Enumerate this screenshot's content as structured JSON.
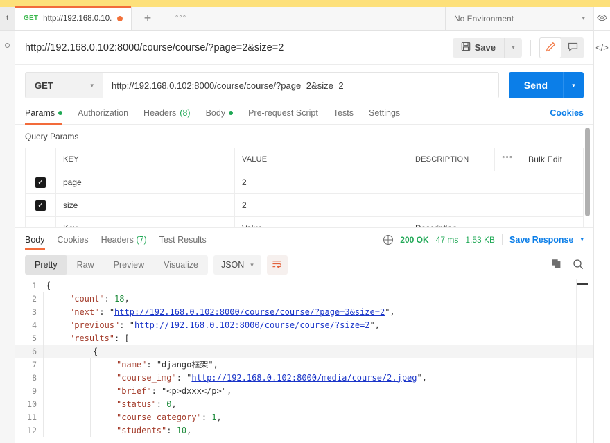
{
  "window": {
    "accent_orange": "#f26b3a",
    "accent_blue": "#0b7ee8",
    "accent_green": "#1fa855",
    "top_bar_color": "#fde07a"
  },
  "tabstrip": {
    "request_tab": {
      "method": "GET",
      "name": "http://192.168.0.10...",
      "unsaved": true
    },
    "new_tab_label": "+",
    "more_label": "°°°",
    "environment": {
      "value": "No Environment"
    }
  },
  "title_bar": {
    "title": "http://192.168.0.102:8000/course/course/?page=2&size=2",
    "save_label": "Save",
    "save_icon": "floppy-disk-icon",
    "caret_icon": "chevron-down-icon",
    "edit_icon": "pencil-icon",
    "comment_icon": "comment-icon"
  },
  "request": {
    "method": "GET",
    "url": "http://192.168.0.102:8000/course/course/?page=2&size=2",
    "send_label": "Send"
  },
  "request_tabs": {
    "items": [
      {
        "label": "Params",
        "badge": "dot",
        "active": true
      },
      {
        "label": "Authorization",
        "badge": "",
        "active": false
      },
      {
        "label": "Headers",
        "badge": "(8)",
        "active": false
      },
      {
        "label": "Body",
        "badge": "dot",
        "active": false
      },
      {
        "label": "Pre-request Script",
        "badge": "",
        "active": false
      },
      {
        "label": "Tests",
        "badge": "",
        "active": false
      },
      {
        "label": "Settings",
        "badge": "",
        "active": false
      }
    ],
    "cookies_label": "Cookies"
  },
  "params": {
    "section_title": "Query Params",
    "columns": [
      "KEY",
      "VALUE",
      "DESCRIPTION"
    ],
    "more_label": "°°°",
    "bulk_edit_label": "Bulk Edit",
    "rows": [
      {
        "checked": true,
        "key": "page",
        "value": "2",
        "description": ""
      },
      {
        "checked": true,
        "key": "size",
        "value": "2",
        "description": ""
      }
    ],
    "placeholder_row": {
      "key": "Key",
      "value": "Value",
      "description": "Description"
    }
  },
  "response": {
    "tabs": [
      {
        "label": "Body",
        "badge": "",
        "active": true
      },
      {
        "label": "Cookies",
        "badge": "",
        "active": false
      },
      {
        "label": "Headers",
        "badge": "(7)",
        "active": false
      },
      {
        "label": "Test Results",
        "badge": "",
        "active": false
      }
    ],
    "status": "200 OK",
    "time": "47 ms",
    "size": "1.53 KB",
    "save_response_label": "Save Response",
    "globe_icon": "globe-icon",
    "view_modes": [
      {
        "label": "Pretty",
        "active": true
      },
      {
        "label": "Raw",
        "active": false
      },
      {
        "label": "Preview",
        "active": false
      },
      {
        "label": "Visualize",
        "active": false
      }
    ],
    "format": "JSON",
    "wrap_icon": "wrap-lines-icon",
    "copy_icon": "copy-icon",
    "search_icon": "search-icon"
  },
  "json_body": {
    "lines": [
      {
        "n": "1",
        "indent": 0,
        "highlight": false,
        "segments": [
          {
            "t": "{",
            "c": "p"
          }
        ]
      },
      {
        "n": "2",
        "indent": 1,
        "highlight": false,
        "segments": [
          {
            "t": "\"count\"",
            "c": "k"
          },
          {
            "t": ": ",
            "c": "p"
          },
          {
            "t": "18",
            "c": "num"
          },
          {
            "t": ",",
            "c": "p"
          }
        ]
      },
      {
        "n": "3",
        "indent": 1,
        "highlight": false,
        "segments": [
          {
            "t": "\"next\"",
            "c": "k"
          },
          {
            "t": ": ",
            "c": "p"
          },
          {
            "t": "\"",
            "c": "str"
          },
          {
            "t": "http://192.168.0.102:8000/course/course/?page=3&size=2",
            "c": "lnk"
          },
          {
            "t": "\",",
            "c": "str"
          }
        ]
      },
      {
        "n": "4",
        "indent": 1,
        "highlight": false,
        "segments": [
          {
            "t": "\"previous\"",
            "c": "k"
          },
          {
            "t": ": ",
            "c": "p"
          },
          {
            "t": "\"",
            "c": "str"
          },
          {
            "t": "http://192.168.0.102:8000/course/course/?size=2",
            "c": "lnk"
          },
          {
            "t": "\",",
            "c": "str"
          }
        ]
      },
      {
        "n": "5",
        "indent": 1,
        "highlight": false,
        "segments": [
          {
            "t": "\"results\"",
            "c": "k"
          },
          {
            "t": ": ",
            "c": "p"
          },
          {
            "t": "[",
            "c": "p"
          }
        ]
      },
      {
        "n": "6",
        "indent": 2,
        "highlight": true,
        "segments": [
          {
            "t": "{",
            "c": "p"
          }
        ]
      },
      {
        "n": "7",
        "indent": 3,
        "highlight": false,
        "segments": [
          {
            "t": "\"name\"",
            "c": "k"
          },
          {
            "t": ": ",
            "c": "p"
          },
          {
            "t": "\"django框架\",",
            "c": "str"
          }
        ]
      },
      {
        "n": "8",
        "indent": 3,
        "highlight": false,
        "segments": [
          {
            "t": "\"course_img\"",
            "c": "k"
          },
          {
            "t": ": ",
            "c": "p"
          },
          {
            "t": "\"",
            "c": "str"
          },
          {
            "t": "http://192.168.0.102:8000/media/course/2.jpeg",
            "c": "lnk"
          },
          {
            "t": "\",",
            "c": "str"
          }
        ]
      },
      {
        "n": "9",
        "indent": 3,
        "highlight": false,
        "segments": [
          {
            "t": "\"brief\"",
            "c": "k"
          },
          {
            "t": ": ",
            "c": "p"
          },
          {
            "t": "\"<p>dxxx</p>\",",
            "c": "str"
          }
        ]
      },
      {
        "n": "10",
        "indent": 3,
        "highlight": false,
        "segments": [
          {
            "t": "\"status\"",
            "c": "k"
          },
          {
            "t": ": ",
            "c": "p"
          },
          {
            "t": "0",
            "c": "num"
          },
          {
            "t": ",",
            "c": "p"
          }
        ]
      },
      {
        "n": "11",
        "indent": 3,
        "highlight": false,
        "segments": [
          {
            "t": "\"course_category\"",
            "c": "k"
          },
          {
            "t": ": ",
            "c": "p"
          },
          {
            "t": "1",
            "c": "num"
          },
          {
            "t": ",",
            "c": "p"
          }
        ]
      },
      {
        "n": "12",
        "indent": 3,
        "highlight": false,
        "segments": [
          {
            "t": "\"students\"",
            "c": "k"
          },
          {
            "t": ": ",
            "c": "p"
          },
          {
            "t": "10",
            "c": "num"
          },
          {
            "t": ",",
            "c": "p"
          }
        ]
      }
    ]
  },
  "rails": {
    "left_stub": "t",
    "right_eye_icon": "eye-icon",
    "right_code_icon": "code-brackets-icon"
  }
}
